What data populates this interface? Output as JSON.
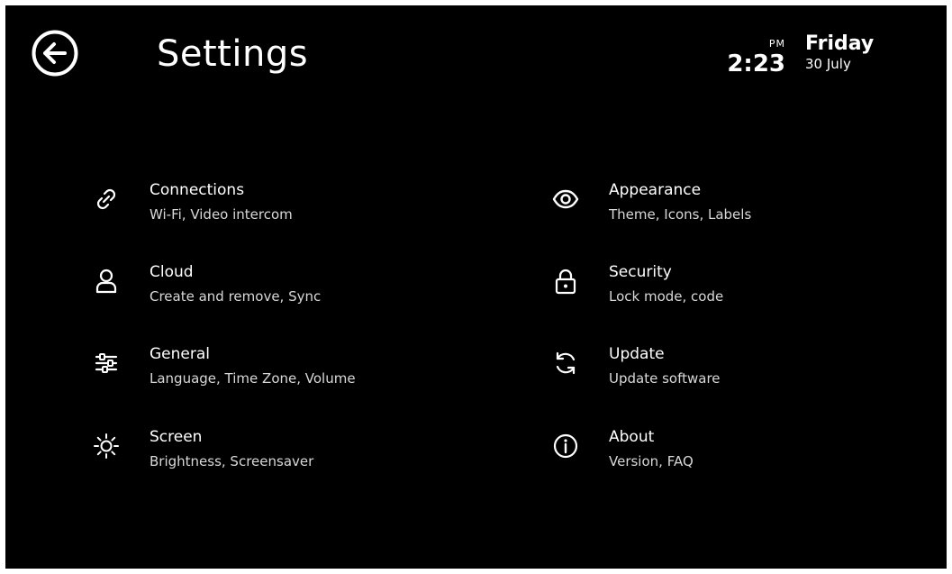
{
  "header": {
    "title": "Settings",
    "back_icon": "back-arrow-circle-icon"
  },
  "status": {
    "ampm": "PM",
    "time": "2:23",
    "day": "Friday",
    "date": "30 July"
  },
  "menu": [
    {
      "label": "Connections",
      "desc": "Wi-Fi, Video intercom",
      "icon": "link-icon"
    },
    {
      "label": "Cloud",
      "desc": "Create and remove, Sync",
      "icon": "user-icon"
    },
    {
      "label": "General",
      "desc": "Language, Time Zone, Volume",
      "icon": "sliders-icon"
    },
    {
      "label": "Screen",
      "desc": "Brightness, Screensaver",
      "icon": "sun-icon"
    },
    {
      "label": "Appearance",
      "desc": "Theme, Icons, Labels",
      "icon": "eye-icon"
    },
    {
      "label": "Security",
      "desc": "Lock mode, code",
      "icon": "lock-icon"
    },
    {
      "label": "Update",
      "desc": "Update software",
      "icon": "refresh-icon"
    },
    {
      "label": "About",
      "desc": "Version, FAQ",
      "icon": "info-icon"
    }
  ],
  "colors": {
    "background": "#000000",
    "text": "#ffffff",
    "secondary_text": "#d8d8d8"
  }
}
